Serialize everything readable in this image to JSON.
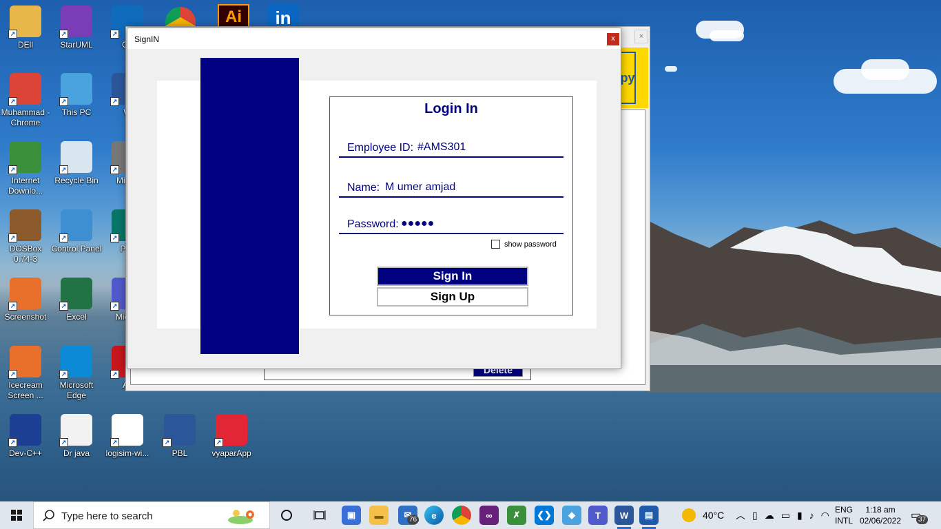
{
  "desktop": {
    "icons": [
      {
        "label": "DEll",
        "icon": "folder-user-icon",
        "color": "#e8b74a"
      },
      {
        "label": "StarUML",
        "icon": "staruml-icon",
        "color": "#7a3db8"
      },
      {
        "label": "Ou",
        "icon": "outlook-icon",
        "color": "#0f6cbd"
      },
      {
        "label": "Muhammad - Chrome",
        "icon": "chrome-profile-icon",
        "color": "#db4437"
      },
      {
        "label": "This PC",
        "icon": "this-pc-icon",
        "color": "#4aa3df"
      },
      {
        "label": "W",
        "icon": "word-icon",
        "color": "#2b579a"
      },
      {
        "label": "Internet Downlo...",
        "icon": "idm-icon",
        "color": "#3a8f3a"
      },
      {
        "label": "Recycle Bin",
        "icon": "recycle-bin-icon",
        "color": "#d9e6ef"
      },
      {
        "label": "Mi Ins",
        "icon": "installer-icon",
        "color": "#777777"
      },
      {
        "label": "DOSBox 0.74-3",
        "icon": "dosbox-icon",
        "color": "#8b5a2b"
      },
      {
        "label": "Control Panel",
        "icon": "control-panel-icon",
        "color": "#3d8fd1"
      },
      {
        "label": "Pub",
        "icon": "publisher-icon",
        "color": "#077568"
      },
      {
        "label": "Screenshot",
        "icon": "screenshot-icon",
        "color": "#e8702a"
      },
      {
        "label": "Excel",
        "icon": "excel-icon",
        "color": "#217346"
      },
      {
        "label": "Mic Te",
        "icon": "teams-icon",
        "color": "#5059c9"
      },
      {
        "label": "Icecream Screen ...",
        "icon": "icecream-icon",
        "color": "#e8702a"
      },
      {
        "label": "Microsoft Edge",
        "icon": "edge-icon",
        "color": "#0c8ad6"
      },
      {
        "label": "Ac",
        "icon": "acrobat-icon",
        "color": "#c4161c"
      },
      {
        "label": "Dev-C++",
        "icon": "devcpp-icon",
        "color": "#1c3f94"
      },
      {
        "label": "Dr java",
        "icon": "java-icon",
        "color": "#f2f2f2"
      },
      {
        "label": "logisim-wi...",
        "icon": "logisim-icon",
        "color": "#ffffff"
      },
      {
        "label": "PBL",
        "icon": "word-doc-icon",
        "color": "#2b579a"
      },
      {
        "label": "vyaparApp",
        "icon": "vyapar-icon",
        "color": "#e32636"
      }
    ],
    "top_partial": [
      "Ai",
      "in"
    ]
  },
  "background_window": {
    "yellow_text": "py",
    "delete_label": "Delete"
  },
  "dialog": {
    "title": "SignIN",
    "close_label": "x",
    "heading": "Login In",
    "employee_id_label": "Employee ID:",
    "employee_id_value": "#AMS301",
    "name_label": "Name:",
    "name_value": "M umer amjad",
    "password_label": "Password:",
    "password_value": "●●●●●",
    "show_password_label": "show password",
    "signin_label": "Sign In",
    "signup_label": "Sign Up",
    "accent": "#000080"
  },
  "taskbar": {
    "search_placeholder": "Type here to search",
    "mail_badge": "76",
    "weather": "40°C",
    "language": "ENG",
    "layout": "INTL",
    "time": "1:18 am",
    "date": "02/06/2022",
    "notifications": "37"
  }
}
